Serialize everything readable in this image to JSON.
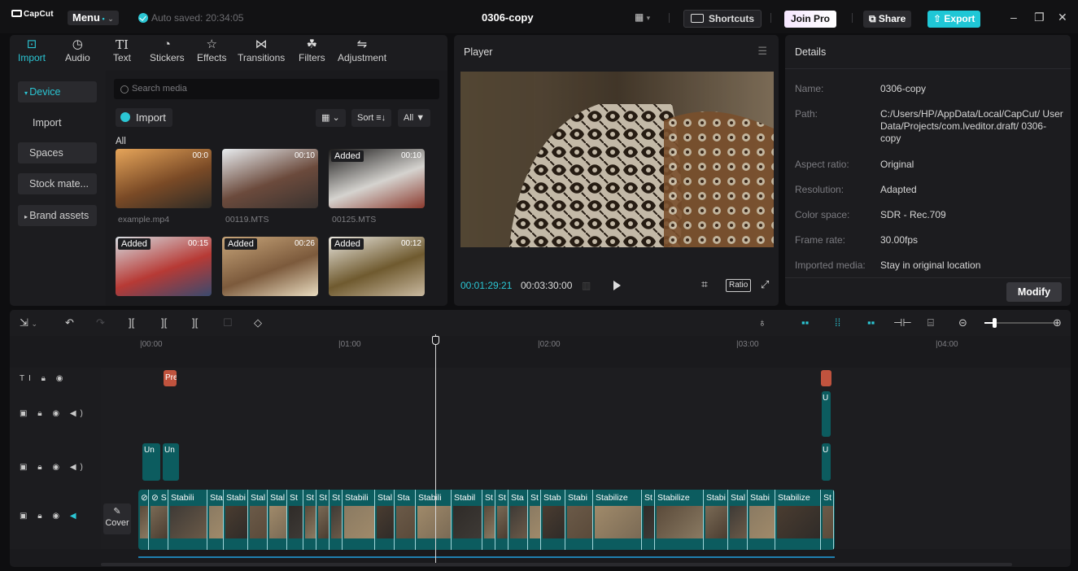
{
  "app": {
    "logo": "CapCut",
    "menu_label": "Menu",
    "autosave": "Auto saved: 20:34:05",
    "project_title": "0306-copy"
  },
  "topbar": {
    "shortcuts": "Shortcuts",
    "join_pro": "Join Pro",
    "share": "Share",
    "export": "Export"
  },
  "tools": [
    {
      "label": "Import",
      "icon": "import-icon",
      "glyph": "⊡"
    },
    {
      "label": "Audio",
      "icon": "audio-icon",
      "glyph": "◷"
    },
    {
      "label": "Text",
      "icon": "text-icon",
      "glyph": "TI"
    },
    {
      "label": "Stickers",
      "icon": "stickers-icon",
      "glyph": "◔"
    },
    {
      "label": "Effects",
      "icon": "effects-icon",
      "glyph": "☆"
    },
    {
      "label": "Transitions",
      "icon": "transitions-icon",
      "glyph": "⋈"
    },
    {
      "label": "Filters",
      "icon": "filters-icon",
      "glyph": "☘"
    },
    {
      "label": "Adjustment",
      "icon": "adjustment-icon",
      "glyph": "⇋"
    }
  ],
  "sidebar": {
    "items": [
      "Device",
      "Import",
      "Spaces",
      "Stock mate...",
      "Brand assets"
    ]
  },
  "media": {
    "search_placeholder": "Search media",
    "import_label": "Import",
    "sort_label": "Sort",
    "all_filter": "All",
    "all_label": "All",
    "thumbs": [
      {
        "name": "example.mp4",
        "duration": "00:0",
        "added": "",
        "colors": [
          "#e6a55a",
          "#7a4a26",
          "#2e2b26"
        ]
      },
      {
        "name": "00119.MTS",
        "duration": "00:10",
        "added": "",
        "colors": [
          "#e8ecef",
          "#6b4a3c",
          "#3a3330"
        ]
      },
      {
        "name": "00125.MTS",
        "duration": "00:10",
        "added": "Added",
        "colors": [
          "#1b1a1a",
          "#d5d3cf",
          "#8b3a2e"
        ]
      },
      {
        "name": "",
        "duration": "00:15",
        "added": "Added",
        "colors": [
          "#d6dde2",
          "#b73a35",
          "#3a4a6e"
        ]
      },
      {
        "name": "",
        "duration": "00:26",
        "added": "Added",
        "colors": [
          "#c7a57a",
          "#7c5a3c",
          "#e9dcc0"
        ]
      },
      {
        "name": "",
        "duration": "00:12",
        "added": "Added",
        "colors": [
          "#e9e6de",
          "#6f5a2f",
          "#c9b9a0"
        ]
      }
    ]
  },
  "player": {
    "title": "Player",
    "current_time": "00:01:29:21",
    "total_time": "00:03:30:00",
    "ratio_label": "Ratio"
  },
  "details": {
    "title": "Details",
    "rows": [
      {
        "k": "Name:",
        "v": "0306-copy"
      },
      {
        "k": "Path:",
        "v": "C:/Users/HP/AppData/Local/CapCut/ User Data/Projects/com.lveditor.draft/ 0306-copy"
      },
      {
        "k": "Aspect ratio:",
        "v": "Original"
      },
      {
        "k": "Resolution:",
        "v": "Adapted"
      },
      {
        "k": "Color space:",
        "v": "SDR - Rec.709"
      },
      {
        "k": "Frame rate:",
        "v": "30.00fps"
      },
      {
        "k": "Imported media:",
        "v": "Stay in original location"
      }
    ],
    "modify": "Modify"
  },
  "timeline": {
    "ruler": [
      "|00:00",
      "|01:00",
      "|02:00",
      "|03:00",
      "|04:00"
    ],
    "cover_label": "Cover",
    "text_clip_label": "Pre",
    "overlay_labels": [
      "Un",
      "Un",
      "U",
      "U"
    ],
    "main_labels": [
      "⊘ S",
      "⊘ S",
      "Stabili",
      "Sta",
      "Stabi",
      "Stal",
      "Stal",
      "St",
      "St",
      "St",
      "St",
      "Stabili",
      "Stal",
      "Sta",
      "Stabili",
      "Stabil",
      "St",
      "St",
      "Sta",
      "St",
      "Stab",
      "Stabi",
      "Stabilize",
      "St",
      "Stabilize",
      "Stabi",
      "Stal",
      "Stabi",
      "Stabilize",
      "St"
    ]
  },
  "colors": {
    "accent": "#2bc6d4",
    "clip_teal": "#0c5c5f",
    "text_clip": "#c0533e"
  }
}
